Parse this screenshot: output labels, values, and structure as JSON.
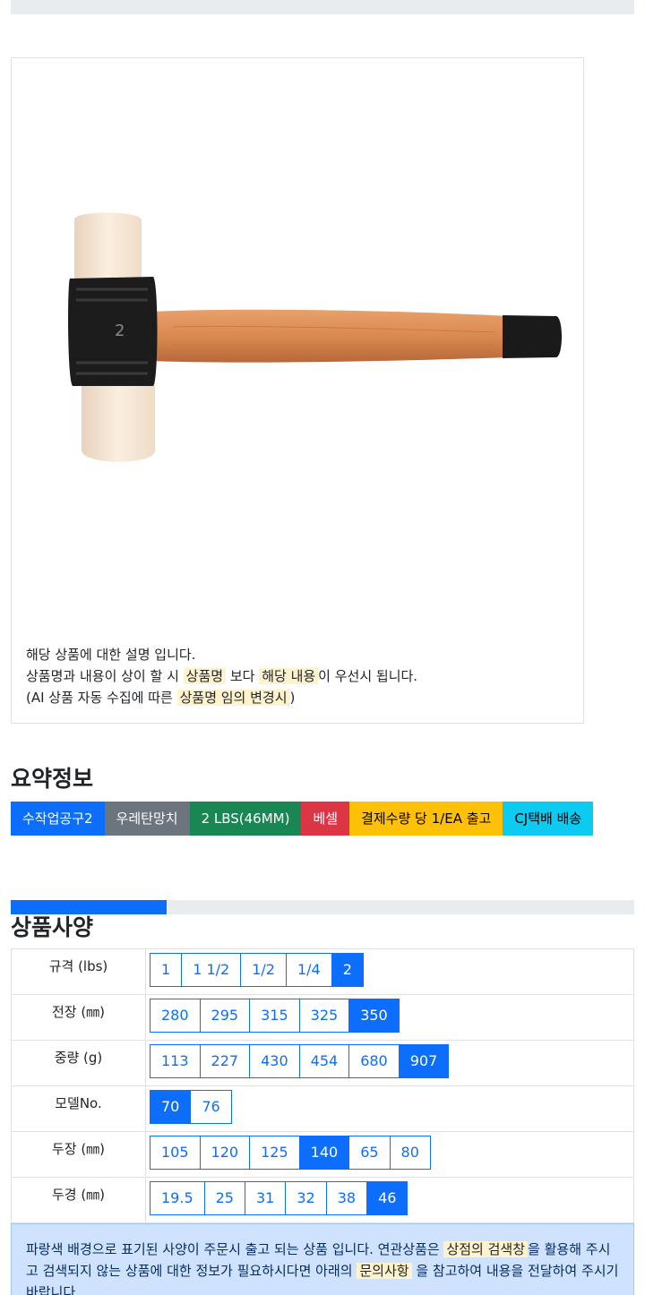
{
  "product": {
    "image_alt": "hammer-image",
    "desc_line1": "해당 상품에 대한 설명 입니다.",
    "desc_line2_a": "상품명과 내용이 상이 할 시 ",
    "desc_line2_hl1": "상품명",
    "desc_line2_b": " 보다 ",
    "desc_line2_hl2": "해당 내용",
    "desc_line2_c": "이 우선시 됩니다.",
    "desc_line3_a": "(AI 상품 자동 수집에 따른 ",
    "desc_line3_hl": "상품명 임의 변경시",
    "desc_line3_b": ")",
    "head_stamp": "2"
  },
  "summary": {
    "title": "요약정보",
    "badges": [
      {
        "label": "수작업공구2",
        "color": "#0d6efd"
      },
      {
        "label": "우레탄망치",
        "color": "#6c757d"
      },
      {
        "label": "2 LBS(46MM)",
        "color": "#198754"
      },
      {
        "label": "베셀",
        "color": "#dc3545"
      },
      {
        "label": "결제수량 당 1/EA 출고",
        "color": "#ffc107"
      },
      {
        "label": "CJ택배 배송",
        "color": "#0dcaf0"
      }
    ]
  },
  "progress": {
    "value": 0.25
  },
  "specs": {
    "title": "상품사양",
    "rows": [
      {
        "label": "규격 (lbs)",
        "options": [
          "1",
          "1 1/2",
          "1/2",
          "1/4",
          "2"
        ],
        "active": 4
      },
      {
        "label": "전장 (㎜)",
        "options": [
          "280",
          "295",
          "315",
          "325",
          "350"
        ],
        "active": 4
      },
      {
        "label": "중량 (g)",
        "options": [
          "113",
          "227",
          "430",
          "454",
          "680",
          "907"
        ],
        "active": 5
      },
      {
        "label": "모델No.",
        "options": [
          "70",
          "76"
        ],
        "active": 0
      },
      {
        "label": "두장 (㎜)",
        "options": [
          "105",
          "120",
          "125",
          "140",
          "65",
          "80"
        ],
        "active": 3
      },
      {
        "label": "두경 (㎜)",
        "options": [
          "19.5",
          "25",
          "31",
          "32",
          "38",
          "46"
        ],
        "active": 5
      }
    ]
  },
  "notice": {
    "text_a": "파랑색 배경으로 표기된 사양이 주문시 출고 되는 상품 입니다. 연관상품은 ",
    "hl1": "상점의 검색창",
    "text_b": "을 활용해 주시고 검색되지 않는 상품에 대한 정보가 필요하시다면 아래의 ",
    "hl2": "문의사항",
    "text_c": " 을 참고하여 내용을 전달하여 주시기 바랍니다."
  }
}
